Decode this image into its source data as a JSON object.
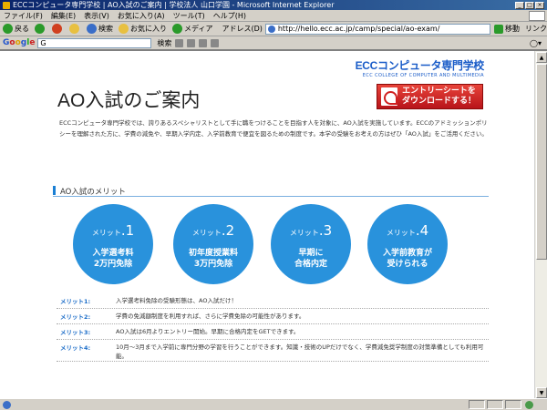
{
  "window": {
    "title": "ECCコンピュータ専門学校 | AO入試のご案内 | 学校法人 山口学園 - Microsoft Internet Explorer"
  },
  "menu": [
    "ファイル(F)",
    "編集(E)",
    "表示(V)",
    "お気に入り(A)",
    "ツール(T)",
    "ヘルプ(H)"
  ],
  "toolbar": {
    "back": "戻る",
    "search": "検索",
    "favorites": "お気に入り",
    "media": "メディア",
    "address_label": "アドレス(D)",
    "url": "http://hello.ecc.ac.jp/camp/special/ao-exam/",
    "go": "移動",
    "links": "リンク"
  },
  "google_bar": {
    "logo": [
      "G",
      "o",
      "o",
      "g",
      "l",
      "e"
    ],
    "input": "G",
    "search_button": "検索"
  },
  "page": {
    "logo_main": "ECCコンピュータ専門学校",
    "logo_sub": "ECC COLLEGE OF COMPUTER AND MULTIMEDIA",
    "title": "AO入試のご案内",
    "entry_button": [
      "エントリーシートを",
      "ダウンロードする！"
    ],
    "intro": "ECCコンピュータ専門学校では、誇りあるスペシャリストとして手に職をつけることを目指す人を対象に、AO入試を実施しています。ECCのアドミッションポリシーを理解された方に、学費の減免や、早期入学内定、入学前教育で便宜を図るための制度です。本学の受験をお考えの方はぜひ「AO入試」をご活用ください。",
    "section_title": "AO入試のメリット",
    "merits": [
      {
        "label": "メリット",
        "num": ".1",
        "line1": "入学選考料",
        "line2": "2万円免除"
      },
      {
        "label": "メリット",
        "num": ".2",
        "line1": "初年度授業料",
        "line2": "3万円免除"
      },
      {
        "label": "メリット",
        "num": ".3",
        "line1": "早期に",
        "line2": "合格内定"
      },
      {
        "label": "メリット",
        "num": ".4",
        "line1": "入学前教育が",
        "line2": "受けられる"
      }
    ],
    "merit_details": [
      {
        "key": "メリット1:",
        "text": "入学選考料免除の受験形態は、AO入試だけ！"
      },
      {
        "key": "メリット2:",
        "text": "学費の免減額制度を利用すれば、さらに学費免除の可能性があります。"
      },
      {
        "key": "メリット3:",
        "text": "AO入試は6月よりエントリー開始。早期に合格内定をGETできます。"
      },
      {
        "key": "メリット4:",
        "text": "10月〜3月まで入学前に専門分野の学習を行うことができます。知識・技術のUPだけでなく、学費減免奨学制度の対策準備としても利用可能。"
      }
    ]
  },
  "colors": {
    "brand": "#1a5cc8",
    "merit_circle": "#2992dc",
    "entry_button": "#d0242a"
  }
}
